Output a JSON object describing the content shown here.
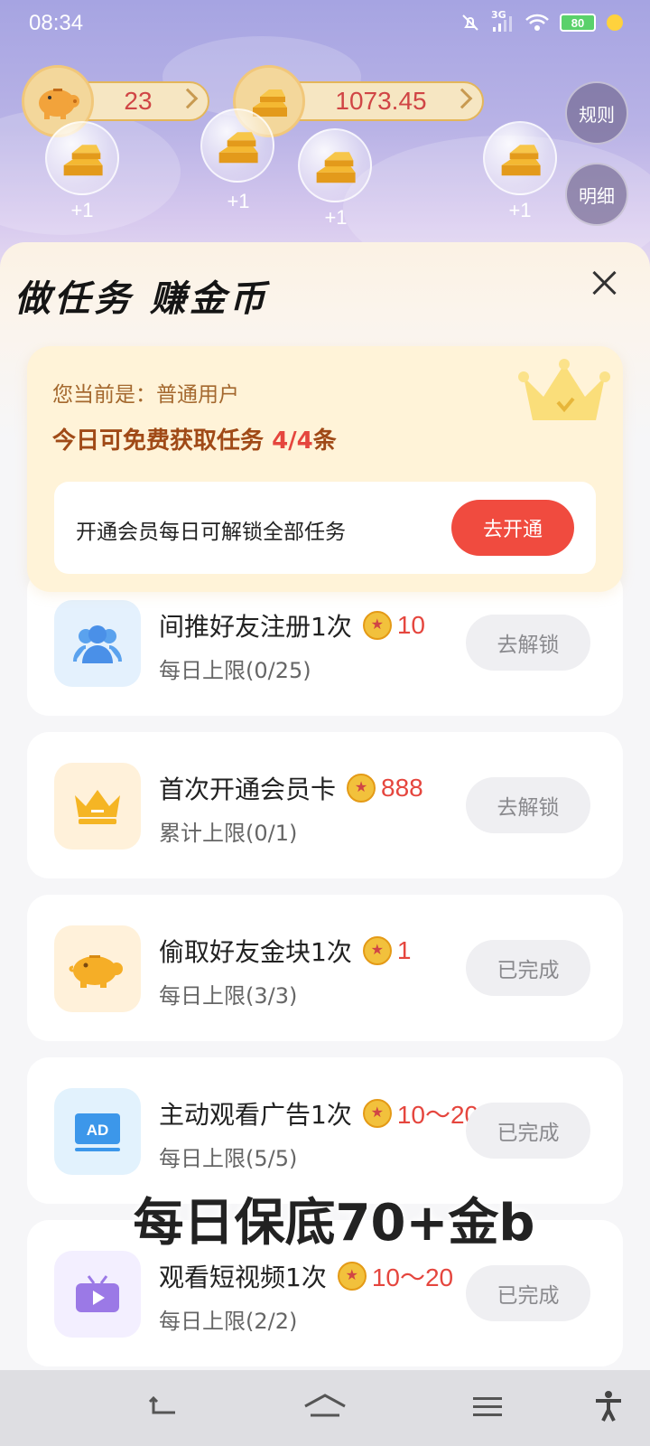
{
  "status_bar": {
    "time": "08:34",
    "network": "3G",
    "battery": "80",
    "icons": [
      "mute-icon",
      "signal-icon",
      "wifi-icon",
      "battery-icon",
      "charging-icon"
    ]
  },
  "header": {
    "piggy_count": "23",
    "gold_count": "1073.45",
    "rules_label": "规则",
    "details_label": "明细",
    "bubbles": [
      {
        "label": "+1"
      },
      {
        "label": "+1"
      },
      {
        "label": "+1"
      },
      {
        "label": "+1"
      }
    ]
  },
  "panel": {
    "title": "做任务 赚金币",
    "member": {
      "status": "您当前是：普通用户",
      "free_prefix": "今日可免费获取任务 ",
      "free_count": "4/4",
      "free_suffix": "条",
      "unlock_text": "开通会员每日可解锁全部任务",
      "open_button": "去开通"
    },
    "tasks": [
      {
        "title": "间推好友注册1次",
        "reward": "10",
        "limit": "每日上限(0/25)",
        "button": "去解锁",
        "icon": "users-icon"
      },
      {
        "title": "首次开通会员卡",
        "reward": "888",
        "limit": "累计上限(0/1)",
        "button": "去解锁",
        "icon": "crown-icon"
      },
      {
        "title": "偷取好友金块1次",
        "reward": "1",
        "limit": "每日上限(3/3)",
        "button": "已完成",
        "icon": "piggy-bank-icon"
      },
      {
        "title": "主动观看广告1次",
        "reward": "10～20",
        "limit": "每日上限(5/5)",
        "button": "已完成",
        "icon": "ad-icon"
      },
      {
        "title": "观看短视频1次",
        "reward": "10～20",
        "limit": "每日上限(2/2)",
        "button": "已完成",
        "icon": "tv-icon"
      }
    ]
  },
  "overlay_caption": "每日保底70+金b",
  "colors": {
    "accent_red": "#e5463e",
    "gold": "#f2c13c",
    "header_purple": "#a6a4e2"
  }
}
